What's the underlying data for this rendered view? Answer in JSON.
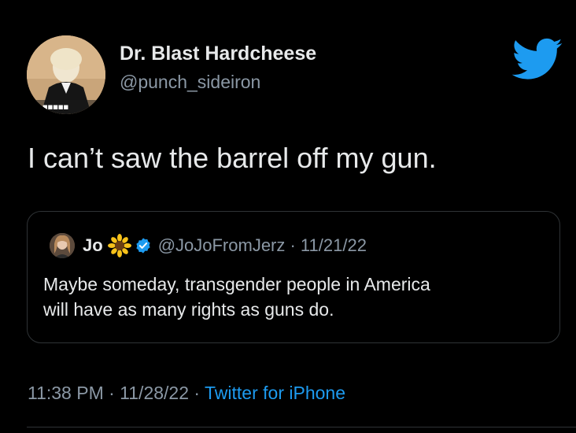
{
  "author": {
    "display_name": "Dr. Blast Hardcheese",
    "handle": "@punch_sideiron",
    "avatar_caption": "■■■■■"
  },
  "tweet": {
    "text": "I can’t saw the barrel off my gun."
  },
  "quoted_tweet": {
    "name": "Jo",
    "handle_date": "@JoJoFromJerz · 11/21/22",
    "text_lines": [
      "Maybe someday, transgender people in America",
      "will have as many rights as guns do."
    ]
  },
  "meta": {
    "time_date": "11:38 PM · 11/28/22 · ",
    "source": "Twitter for iPhone"
  },
  "icons": {
    "brand": "twitter-bird-icon",
    "verified": "verified-badge-icon",
    "emoji": "sunflower-icon"
  },
  "colors": {
    "background": "#000000",
    "primary_text": "#e7e9ea",
    "secondary_text": "#8b98a5",
    "accent": "#1d9bf0",
    "border": "#2f3336"
  }
}
